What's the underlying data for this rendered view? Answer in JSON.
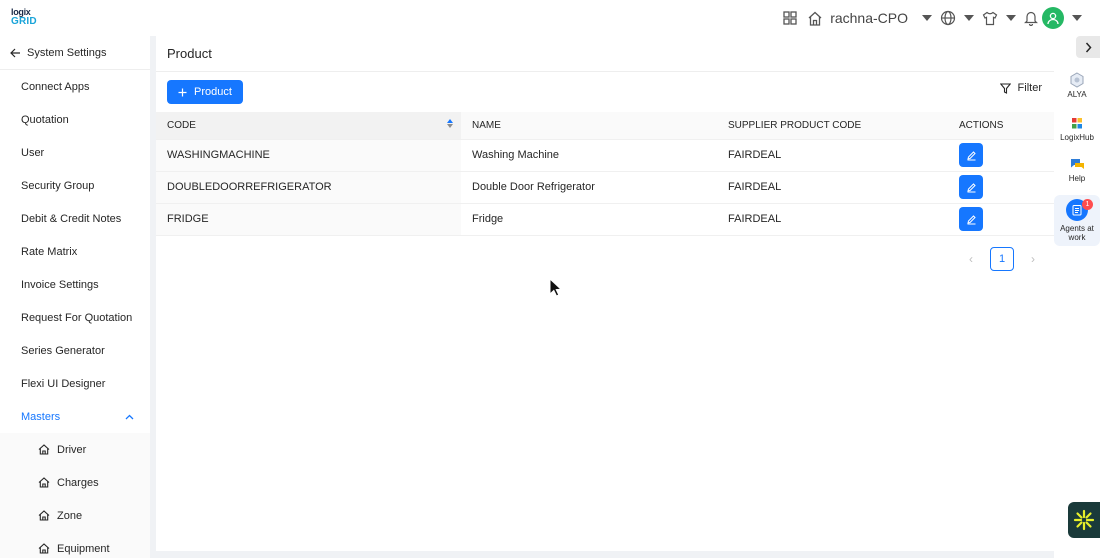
{
  "logo": {
    "line1": "logix",
    "line2": "GRID"
  },
  "topbar": {
    "tenant": "rachna-CPO"
  },
  "sidebar": {
    "back_label": "System Settings",
    "items": [
      {
        "label": "Connect Apps"
      },
      {
        "label": "Quotation"
      },
      {
        "label": "User"
      },
      {
        "label": "Security Group"
      },
      {
        "label": "Debit & Credit Notes"
      },
      {
        "label": "Rate Matrix"
      },
      {
        "label": "Invoice Settings"
      },
      {
        "label": "Request For Quotation"
      },
      {
        "label": "Series Generator"
      },
      {
        "label": "Flexi UI Designer"
      }
    ],
    "masters": {
      "label": "Masters",
      "subitems": [
        {
          "label": "Driver"
        },
        {
          "label": "Charges"
        },
        {
          "label": "Zone"
        },
        {
          "label": "Equipment"
        }
      ]
    }
  },
  "main": {
    "title": "Product",
    "add_label": "Product",
    "filter_label": "Filter",
    "columns": {
      "code": "CODE",
      "name": "NAME",
      "supplier_code": "SUPPLIER PRODUCT CODE",
      "actions": "ACTIONS"
    },
    "rows": [
      {
        "code": "WASHINGMACHINE",
        "name": "Washing Machine",
        "supplier_code": "FAIRDEAL"
      },
      {
        "code": "DOUBLEDOORREFRIGERATOR",
        "name": "Double Door Refrigerator",
        "supplier_code": "FAIRDEAL"
      },
      {
        "code": "FRIDGE",
        "name": "Fridge",
        "supplier_code": "FAIRDEAL"
      }
    ],
    "pagination": {
      "current_page": "1"
    }
  },
  "rail": {
    "alya": "ALYA",
    "logixhub": "LogixHub",
    "help": "Help",
    "agents": "Agents at work",
    "agents_badge": "1"
  },
  "colors": {
    "primary": "#1677ff",
    "avatar": "#25b864",
    "badge": "#ff4d4f"
  }
}
